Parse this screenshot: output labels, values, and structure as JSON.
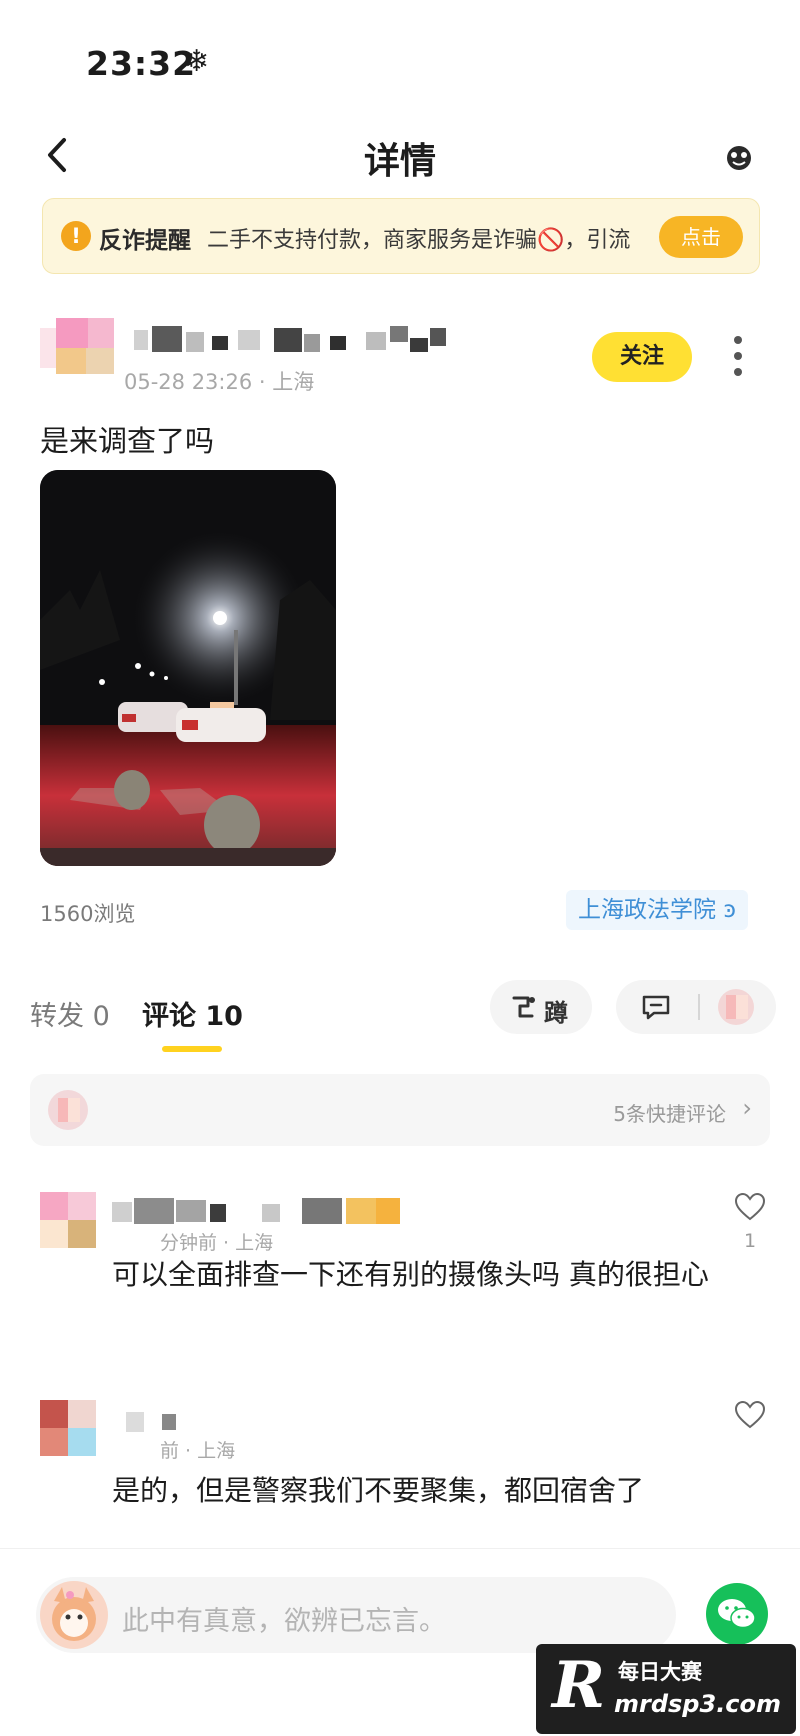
{
  "status_bar": {
    "time": "23:32",
    "indicator": "❄"
  },
  "nav": {
    "title": "详情",
    "back_icon": "chevron-left-icon",
    "right_icon": "emoji-icon"
  },
  "alert": {
    "icon": "!",
    "title": "反诈提醒",
    "text": "二手不支持付款，商家服务是诈骗🚫，引流",
    "button_label": "点击"
  },
  "post": {
    "meta": "05-28 23:26 · 上海",
    "follow_label": "关注",
    "text": "是来调查了吗",
    "views": "1560浏览",
    "topic_tag": "上海政法学院",
    "topic_suffix": "ꜿ"
  },
  "tabs": {
    "repost_label": "转发 0",
    "comment_label": "评论 10",
    "deng_label": "蹲"
  },
  "quick_comments": {
    "text": "5条快捷评论",
    "chevron": "›"
  },
  "comments": [
    {
      "meta": "分钟前 · 上海",
      "text": "可以全面排查一下还有别的摄像头吗 真的很担心",
      "like_count": "1"
    },
    {
      "meta": "前 · 上海",
      "text": "是的，但是警察我们不要聚集，都回宿舍了",
      "like_count": ""
    }
  ],
  "bottom_bar": {
    "placeholder": "此中有真意，欲辨已忘言。"
  },
  "watermark": {
    "logo_letter": "R",
    "name": "每日大赛",
    "url": "mrdsp3.com"
  },
  "colors": {
    "accent_yellow": "#ffe033",
    "alert_bg": "#fdf6dc",
    "link_blue": "#3f8fd6",
    "wechat_green": "#16c05a"
  }
}
